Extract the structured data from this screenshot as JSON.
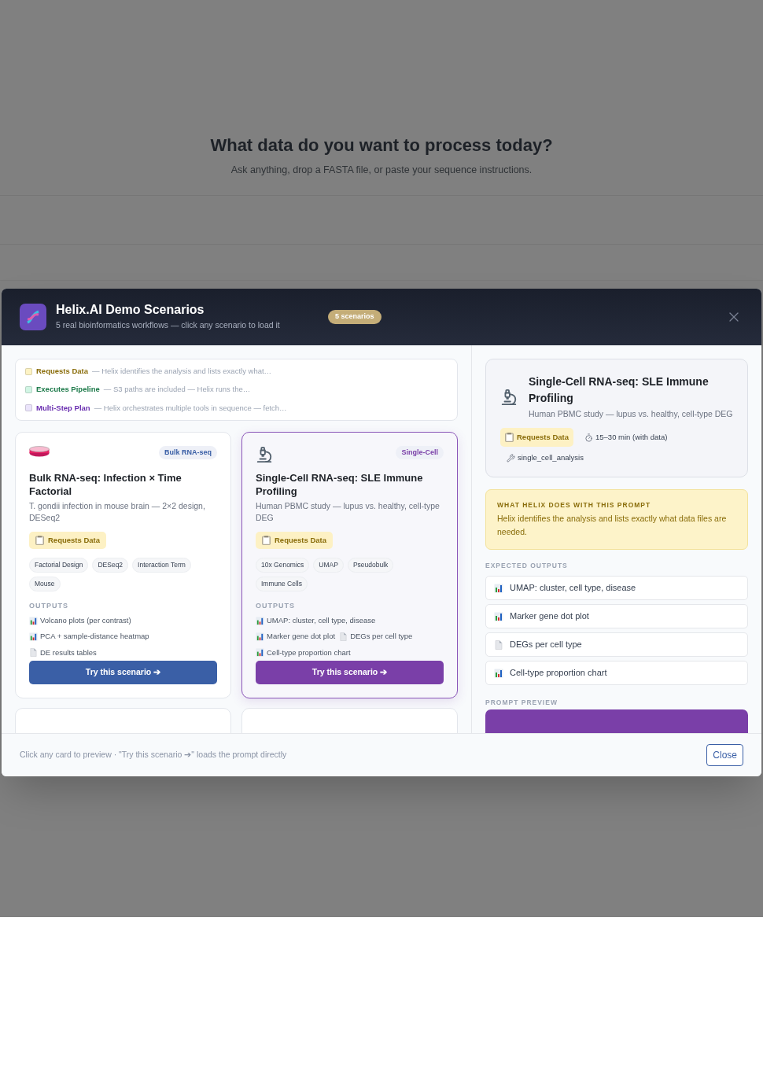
{
  "page": {
    "heading": "What data do you want to process today?",
    "subtitle": "Ask anything, drop a FASTA file, or paste your sequence instructions."
  },
  "modal": {
    "title": "Helix.AI Demo Scenarios",
    "subtitle": "5 real bioinformatics workflows — click any scenario to load it",
    "badge": "5 scenarios",
    "legend": [
      {
        "label": "Requests Data",
        "text": "— Helix identifies the analysis and lists exactly what…",
        "color": "#fdf3c4"
      },
      {
        "label": "Executes Pipeline",
        "text": "— S3 paths are included — Helix runs the…",
        "color": "#d1f5e4"
      },
      {
        "label": "Multi-Step Plan",
        "text": "— Helix orchestrates multiple tools in sequence — fetch…",
        "color": "#ebe4fb"
      }
    ],
    "cards": [
      {
        "kind": "dish",
        "selected": false,
        "color": "#3a5fa6",
        "category": "Bulk RNA-seq",
        "title": "Bulk RNA-seq: Infection × Time Factorial",
        "description": "T. gondii infection in mouse brain — 2×2 design, DESeq2",
        "mode": "Requests Data",
        "tags": [
          "Factorial Design",
          "DESeq2",
          "Interaction Term",
          "Mouse"
        ],
        "outputs_label": "OUTPUTS",
        "outputs": [
          {
            "kind": "chart",
            "text": "Volcano plots (per contrast)"
          },
          {
            "kind": "chart",
            "text": "PCA + sample-distance heatmap"
          },
          {
            "kind": "file",
            "text": "DE results tables"
          }
        ],
        "button": "Try this scenario ➔"
      },
      {
        "kind": "microscope",
        "selected": true,
        "color": "#7a3fa8",
        "category": "Single-Cell",
        "title": "Single-Cell RNA-seq: SLE Immune Profiling",
        "description": "Human PBMC study — lupus vs. healthy, cell-type DEG",
        "mode": "Requests Data",
        "tags": [
          "10x Genomics",
          "UMAP",
          "Pseudobulk",
          "Immune Cells"
        ],
        "outputs_label": "OUTPUTS",
        "outputs": [
          {
            "kind": "chart",
            "text": "UMAP: cluster, cell type, disease"
          },
          {
            "kind": "chart",
            "text": "Marker gene dot plot"
          },
          {
            "kind": "file",
            "text": "DEGs per cell type"
          },
          {
            "kind": "chart",
            "text": "Cell-type proportion chart"
          }
        ],
        "button": "Try this scenario ➔"
      }
    ],
    "preview": {
      "title": "Single-Cell RNA-seq: SLE Immune Profiling",
      "description": "Human PBMC study — lupus vs. healthy, cell-type DEG",
      "mode": "Requests Data",
      "duration": "15–30 min (with data)",
      "tool": "single_cell_analysis",
      "note_heading": "WHAT HELIX DOES WITH THIS PROMPT",
      "note": "Helix identifies the analysis and lists exactly what data files are needed.",
      "outputs_heading": "EXPECTED OUTPUTS",
      "outputs": [
        {
          "kind": "chart",
          "text": "UMAP: cluster, cell type, disease"
        },
        {
          "kind": "chart",
          "text": "Marker gene dot plot"
        },
        {
          "kind": "file",
          "text": "DEGs per cell type"
        },
        {
          "kind": "chart",
          "text": "Cell-type proportion chart"
        }
      ],
      "prompt_heading": "PROMPT PREVIEW"
    },
    "footer": {
      "hint": "Click any card to preview · \"Try this scenario ➔\" loads the prompt directly",
      "close": "Close"
    }
  }
}
